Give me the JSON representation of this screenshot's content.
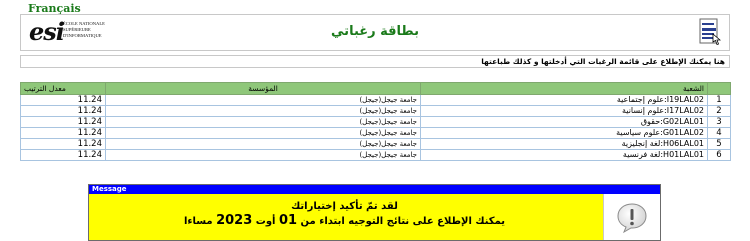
{
  "lang_link": "Français",
  "header": {
    "logo_mark": "esi",
    "logo_text": "ÉCOLE NATIONALE\nSUPÉRIEURE\nD'INFORMATIQUE",
    "title": "بطاقة رغباتي"
  },
  "info_text": "هنا يمكنك الإطلاع على قائمة الرغبات التي أدخلتها و كذلك طباعتها",
  "table": {
    "headers": {
      "moyenne": "معدل الترتيب",
      "etablissement": "المؤسسة",
      "filiere": "الشعبة"
    },
    "rows": [
      {
        "idx": "1",
        "filiere": "I19LAL02:علوم إجتماعية",
        "etablissement": "جامعة جيجل(جيجل)",
        "moyenne": "11.24"
      },
      {
        "idx": "2",
        "filiere": "I17LAL02:علوم إنسانية",
        "etablissement": "جامعة جيجل(جيجل)",
        "moyenne": "11.24"
      },
      {
        "idx": "3",
        "filiere": "G02LAL01:حقوق",
        "etablissement": "جامعة جيجل(جيجل)",
        "moyenne": "11.24"
      },
      {
        "idx": "4",
        "filiere": "G01LAL02:علوم سياسية",
        "etablissement": "جامعة جيجل(جيجل)",
        "moyenne": "11.24"
      },
      {
        "idx": "5",
        "filiere": "H06LAL01:لغة إنجليزية",
        "etablissement": "جامعة جيجل(جيجل)",
        "moyenne": "11.24"
      },
      {
        "idx": "6",
        "filiere": "H01LAL01:لغة فرنسية",
        "etablissement": "جامعة جيجل(جيجل)",
        "moyenne": "11.24"
      }
    ]
  },
  "message": {
    "header": "Message",
    "line1": "لقد تمّ تأكيد إختياراتك",
    "line2_pre": "يمكنك الإطلاع على نتائج التوجيه ابتداء من",
    "line2_day": "01",
    "line2_month": "أوت",
    "line2_year": "2023",
    "line2_post": "مساءا"
  },
  "colors": {
    "accent_green": "#1a7a1a",
    "table_header": "#8fc77a",
    "message_header": "#0000ff",
    "message_body": "#ffff00"
  },
  "icons": {
    "header_icon": "document-print-icon",
    "message_icon": "speech-bubble-exclamation-icon"
  }
}
